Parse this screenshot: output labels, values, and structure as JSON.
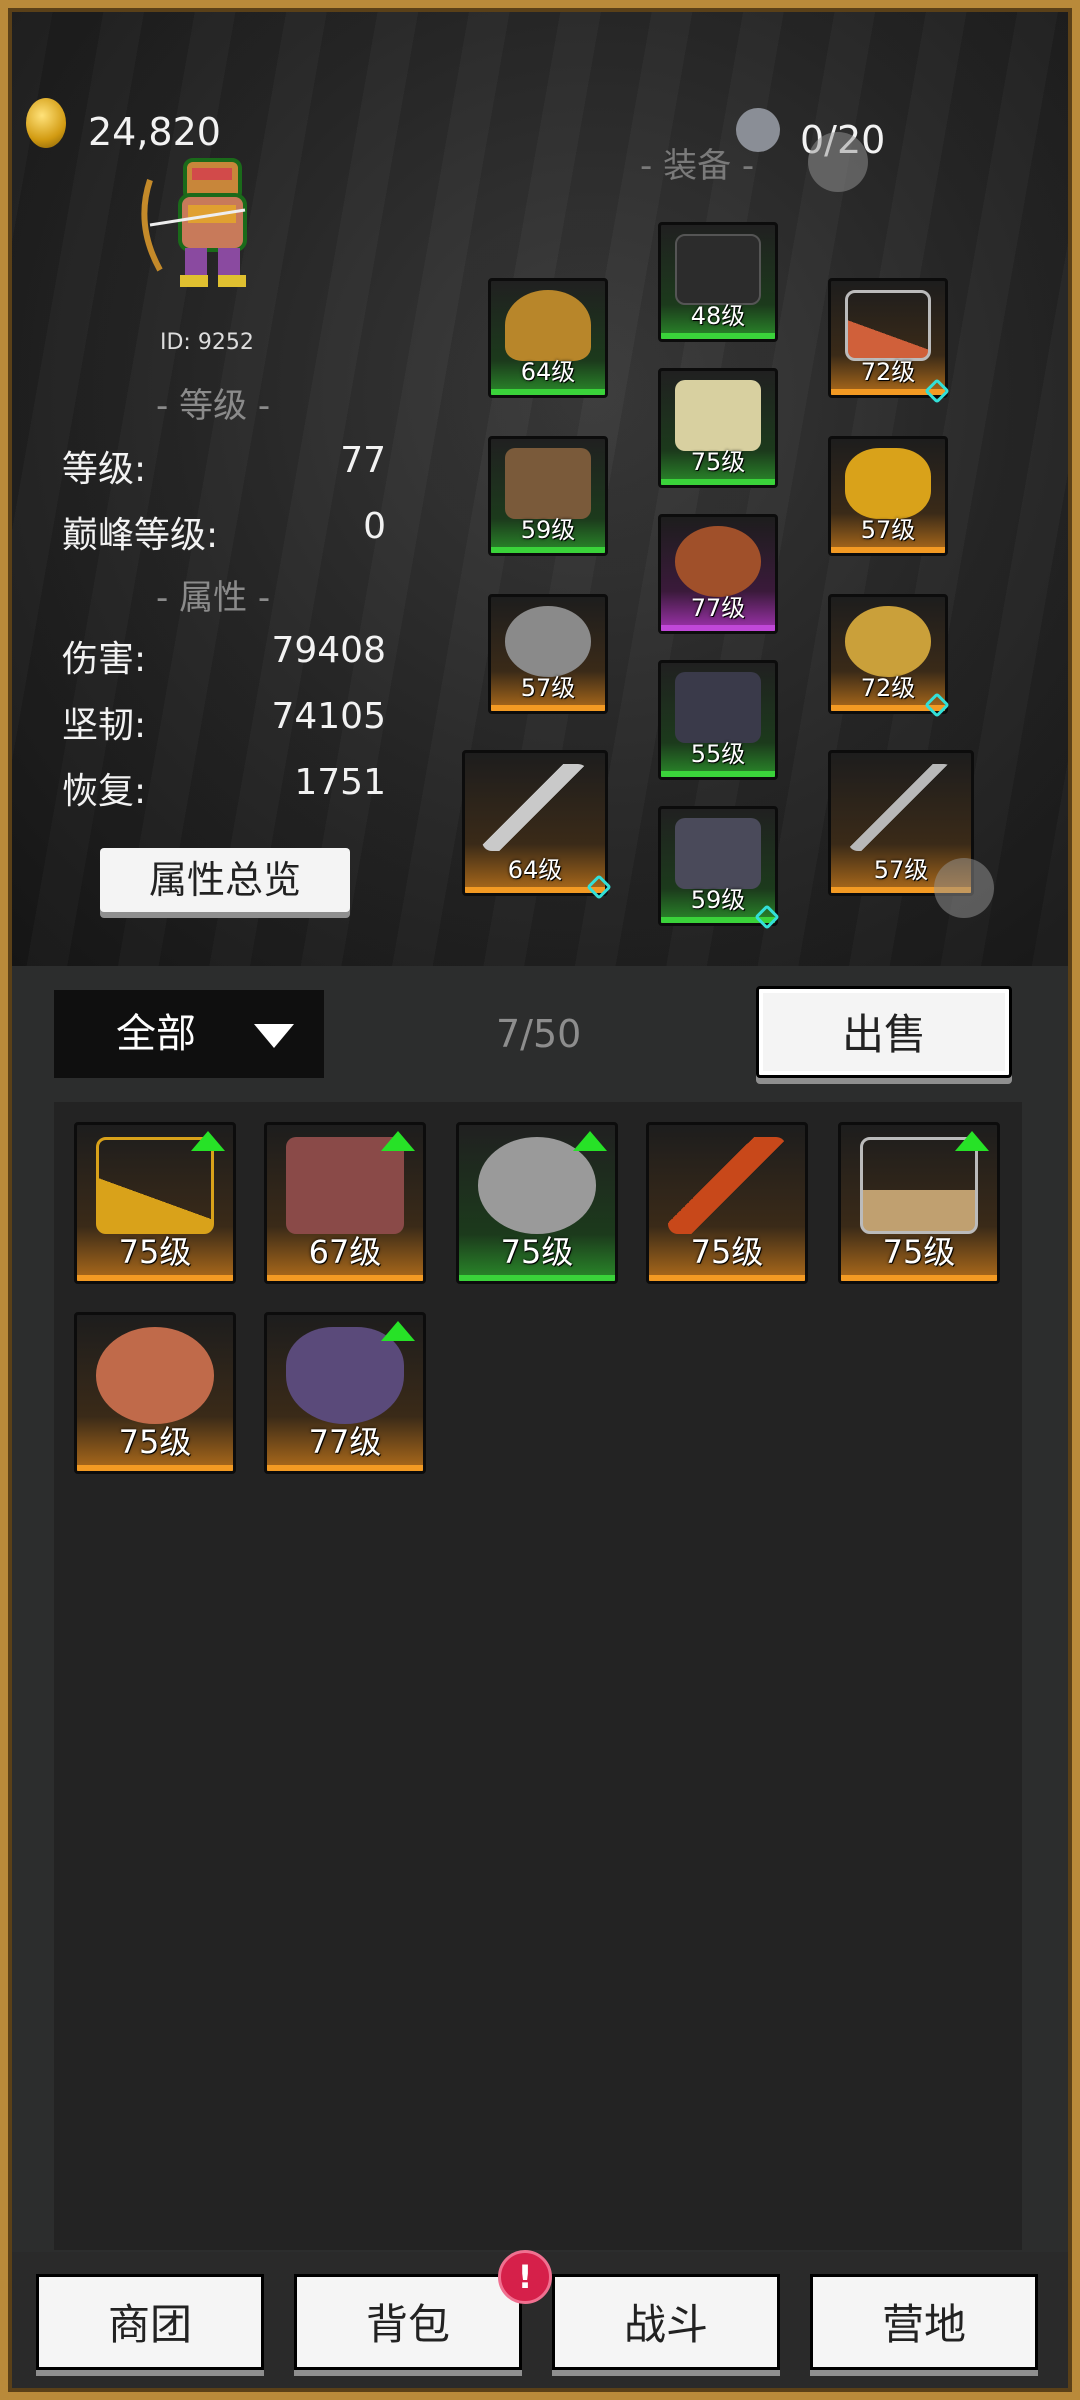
{
  "currency": {
    "gold": "24,820",
    "icon": "gold-coin-icon"
  },
  "player": {
    "id_text": "ID: 9252",
    "avatar_icon": "archer-hero-icon"
  },
  "level_section": {
    "title": "- 等级 -",
    "rows": [
      {
        "label": "等级:",
        "value": "77"
      },
      {
        "label": "巅峰等级:",
        "value": "0"
      }
    ]
  },
  "attr_section": {
    "title": "- 属性 -",
    "rows": [
      {
        "label": "伤害:",
        "value": "79408"
      },
      {
        "label": "坚韧:",
        "value": "74105"
      },
      {
        "label": "恢复:",
        "value": "1751"
      }
    ]
  },
  "overview_button": "属性总览",
  "equipment": {
    "title": "- 装备 -",
    "capacity": "0/20",
    "slots": [
      {
        "name": "helmet",
        "level": "64级",
        "rarity": "green",
        "color": "#b8862a"
      },
      {
        "name": "gloves",
        "level": "59级",
        "rarity": "green",
        "color": "#7a5a3a"
      },
      {
        "name": "ring-left",
        "level": "57级",
        "rarity": "orange",
        "color": "#8a8a8a"
      },
      {
        "name": "main-weapon",
        "level": "64级",
        "rarity": "orange",
        "color": "#c9c9c9",
        "gem": true
      },
      {
        "name": "hood",
        "level": "48级",
        "rarity": "green",
        "color": "#2c2c2c"
      },
      {
        "name": "armor",
        "level": "75级",
        "rarity": "green",
        "color": "#d8d0a0"
      },
      {
        "name": "belt",
        "level": "77级",
        "rarity": "purple",
        "color": "#a0502a"
      },
      {
        "name": "pants",
        "level": "55级",
        "rarity": "green",
        "color": "#3a3a4a"
      },
      {
        "name": "boots",
        "level": "59级",
        "rarity": "green",
        "color": "#4a4a5a",
        "gem": true
      },
      {
        "name": "necklace",
        "level": "72级",
        "rarity": "orange",
        "color": "#d0603a",
        "gem": true
      },
      {
        "name": "bracelet",
        "level": "57级",
        "rarity": "orange",
        "color": "#d9a21a"
      },
      {
        "name": "ring-right",
        "level": "72级",
        "rarity": "orange",
        "color": "#caa03a",
        "gem": true
      },
      {
        "name": "off-weapon",
        "level": "57级",
        "rarity": "orange",
        "color": "#b8b8b8"
      }
    ]
  },
  "inventory": {
    "filter": "全部",
    "count": "7/50",
    "sell_button": "出售",
    "items": [
      {
        "name": "gold-amulet",
        "level": "75级",
        "rarity": "orange",
        "upgrade": true,
        "color": "#d9a21a"
      },
      {
        "name": "leather-boots",
        "level": "67级",
        "rarity": "orange",
        "upgrade": true,
        "color": "#8a4a48"
      },
      {
        "name": "iron-gauntlet",
        "level": "75级",
        "rarity": "green",
        "upgrade": true,
        "color": "#9a9a9a"
      },
      {
        "name": "fire-halberd",
        "level": "75级",
        "rarity": "orange",
        "upgrade": false,
        "color": "#c8481a"
      },
      {
        "name": "shield-pendant",
        "level": "75级",
        "rarity": "orange",
        "upgrade": true,
        "color": "#c0a070"
      },
      {
        "name": "copper-ring",
        "level": "75级",
        "rarity": "orange",
        "upgrade": false,
        "color": "#c06a4a"
      },
      {
        "name": "purple-mask",
        "level": "77级",
        "rarity": "orange",
        "upgrade": true,
        "color": "#5a4a7a"
      }
    ]
  },
  "nav": [
    {
      "label": "商团"
    },
    {
      "label": "背包",
      "badge": "!"
    },
    {
      "label": "战斗"
    },
    {
      "label": "营地"
    }
  ]
}
